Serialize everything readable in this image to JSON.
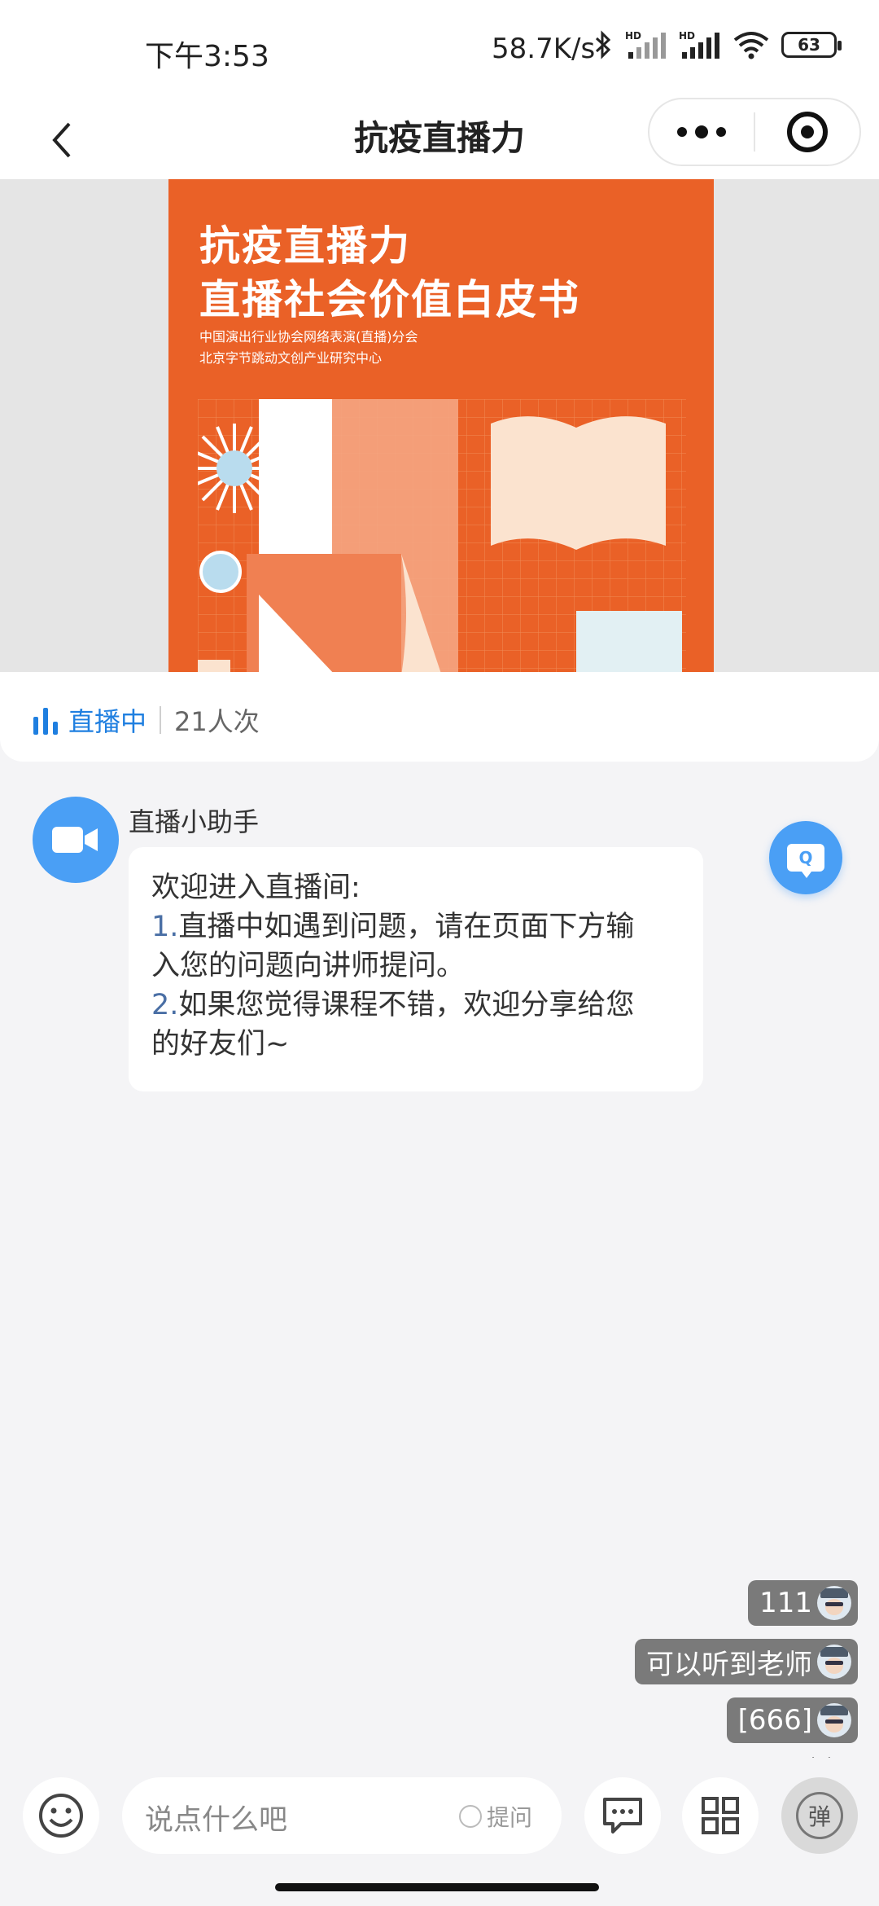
{
  "status_bar": {
    "time": "下午3:53",
    "net_speed": "58.7K/s",
    "battery": "63",
    "icons": [
      "bluetooth-icon",
      "hd-signal-icon",
      "hd-signal-icon",
      "wifi-icon",
      "battery-icon"
    ]
  },
  "nav": {
    "title": "抗疫直播力",
    "back_icon": "chevron-left-icon",
    "more_icon": "more-dots-icon",
    "close_icon": "target-close-icon"
  },
  "cover": {
    "title_line1": "抗疫直播力",
    "title_line2": "直播社会价值白皮书",
    "sub_line1": "中国演出行业协会网络表演(直播)分会",
    "sub_line2": "北京字节跳动文创产业研究中心",
    "colors": {
      "background": "#ea6127",
      "light": "#fbe3cf",
      "accent": "#b9dcee"
    }
  },
  "live": {
    "status": "直播中",
    "views": "21人次",
    "accent": "#1f7fe0"
  },
  "chat": {
    "sender": "直播小助手",
    "lines": [
      {
        "num": "",
        "text": "欢迎进入直播间:"
      },
      {
        "num": "1.",
        "text": "直播中如遇到问题，请在页面下方输"
      },
      {
        "num": "",
        "text": "入您的问题向讲师提问。"
      },
      {
        "num": "2.",
        "text": "如果您觉得课程不错，欢迎分享给您"
      },
      {
        "num": "",
        "text": "的好友们~"
      }
    ],
    "qa_button_label": "Q"
  },
  "danmaku": [
    {
      "text": "111"
    },
    {
      "text": "可以听到老师"
    },
    {
      "text": "[666]"
    }
  ],
  "bottom": {
    "input_placeholder": "说点什么吧",
    "ask_label": "提问",
    "danmu_button": "弹"
  }
}
